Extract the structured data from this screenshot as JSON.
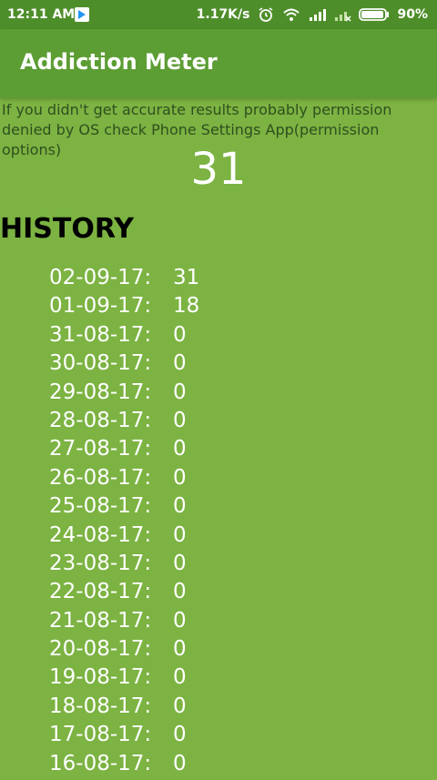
{
  "status": {
    "time": "12:11 AM",
    "speed": "1.17K/s",
    "battery": "90%"
  },
  "app": {
    "title": "Addiction Meter"
  },
  "main": {
    "notice": "If you didn't get accurate results probably permission denied by OS check Phone Settings App(permission options)",
    "count": "31",
    "history_title": "HISTORY",
    "history": [
      {
        "date": "02-09-17:",
        "value": "31"
      },
      {
        "date": "01-09-17:",
        "value": "18"
      },
      {
        "date": "31-08-17:",
        "value": "0"
      },
      {
        "date": "30-08-17:",
        "value": "0"
      },
      {
        "date": "29-08-17:",
        "value": "0"
      },
      {
        "date": "28-08-17:",
        "value": "0"
      },
      {
        "date": "27-08-17:",
        "value": "0"
      },
      {
        "date": "26-08-17:",
        "value": "0"
      },
      {
        "date": "25-08-17:",
        "value": "0"
      },
      {
        "date": "24-08-17:",
        "value": "0"
      },
      {
        "date": "23-08-17:",
        "value": "0"
      },
      {
        "date": "22-08-17:",
        "value": "0"
      },
      {
        "date": "21-08-17:",
        "value": "0"
      },
      {
        "date": "20-08-17:",
        "value": "0"
      },
      {
        "date": "19-08-17:",
        "value": "0"
      },
      {
        "date": "18-08-17:",
        "value": "0"
      },
      {
        "date": "17-08-17:",
        "value": "0"
      },
      {
        "date": "16-08-17:",
        "value": "0"
      }
    ]
  },
  "colors": {
    "background": "#7cb342",
    "appbar": "#5c9d34",
    "statusbar": "#4e8e2a"
  },
  "icons": [
    "play-store-icon",
    "alarm-icon",
    "wifi-icon",
    "signal-icon",
    "signal-x-icon",
    "battery-icon"
  ]
}
